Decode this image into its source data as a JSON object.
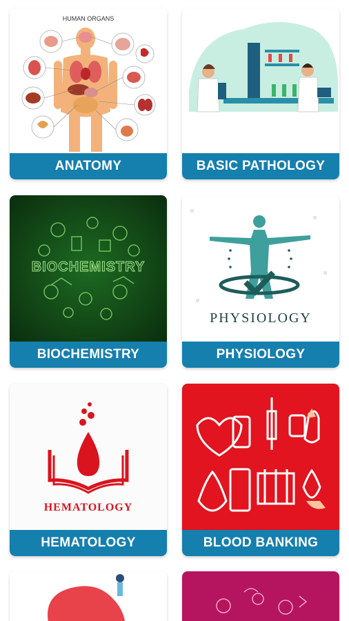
{
  "cards": [
    {
      "label": "ANATOMY",
      "image": {
        "title": "HUMAN ORGANS"
      }
    },
    {
      "label": "BASIC PATHOLOGY"
    },
    {
      "label": "BIOCHEMISTRY",
      "image": {
        "title": "BIOCHEMISTRY"
      }
    },
    {
      "label": "PHYSIOLOGY",
      "image": {
        "title": "PHYSIOLOGY"
      }
    },
    {
      "label": "HEMATOLOGY",
      "image": {
        "title": "HEMATOLOGY"
      }
    },
    {
      "label": "BLOOD BANKING"
    },
    {
      "label": ""
    },
    {
      "label": ""
    }
  ],
  "colors": {
    "label_bg": "#157fae",
    "label_text": "#ffffff",
    "biochem_bg": "#0f3d12",
    "bloodbank_bg": "#e1141f",
    "hematology_red": "#d9141e",
    "physiology_teal": "#3f9f9c",
    "pink_card_bg": "#b5155f"
  },
  "icons": [
    "organ-chart-icon",
    "lab-scientists-icon",
    "molecule-icon",
    "human-figure-icon",
    "blood-drop-book-icon",
    "blood-bag-icon"
  ]
}
